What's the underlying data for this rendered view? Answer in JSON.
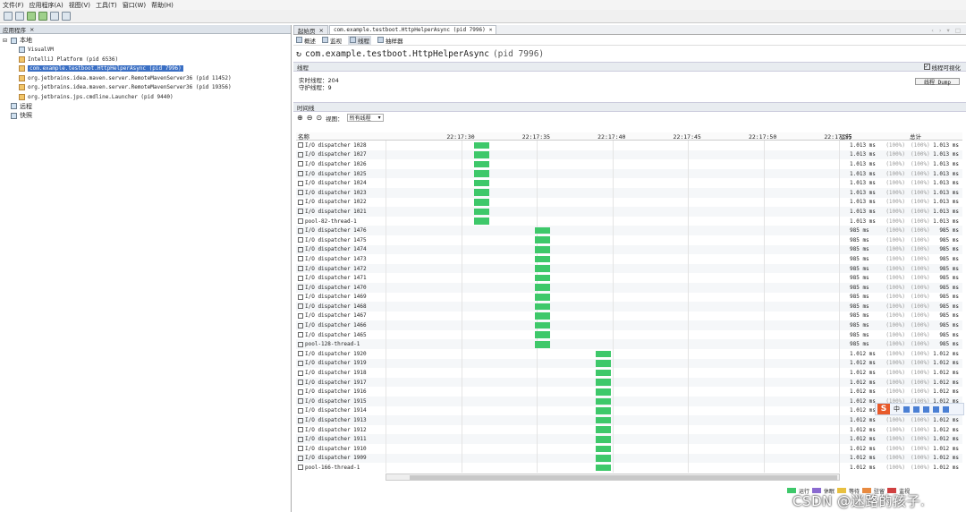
{
  "menu": [
    "文件(F)",
    "应用程序(A)",
    "视图(V)",
    "工具(T)",
    "窗口(W)",
    "帮助(H)"
  ],
  "left_tab": {
    "label": "应用程序",
    "close": "×"
  },
  "tree": {
    "local": "本地",
    "apps": [
      {
        "label": "VisualVM",
        "selected": false
      },
      {
        "label": "IntelliJ Platform (pid 6536)",
        "selected": false
      },
      {
        "label": "com.example.testboot.HttpHelperAsync (pid 7996)",
        "selected": true
      },
      {
        "label": "org.jetbrains.idea.maven.server.RemoteMavenServer36 (pid 11452)",
        "selected": false
      },
      {
        "label": "org.jetbrains.idea.maven.server.RemoteMavenServer36 (pid 19356)",
        "selected": false
      },
      {
        "label": "org.jetbrains.jps.cmdline.Launcher (pid 9440)",
        "selected": false
      }
    ],
    "remote": "远程",
    "snapshot": "快照"
  },
  "tabs": [
    {
      "label": "起始页",
      "close": "×"
    },
    {
      "label": "com.example.testboot.HttpHelperAsync (pid 7996)",
      "close": "×"
    }
  ],
  "tab_nav": "‹ › ▾ □",
  "subtabs": [
    "概述",
    "监视",
    "线程",
    "抽样器"
  ],
  "page_title": "com.example.testboot.HttpHelperAsync",
  "page_pid": "(pid 7996)",
  "threads_section": {
    "label": "线程",
    "visualize_label": "线程可视化",
    "visualize_checked": true
  },
  "stats": {
    "live": "实时线程：204",
    "daemon": "守护线程：9"
  },
  "dump_button": "线程 Dump",
  "timeline_label": "时间线",
  "view_label": "视图：",
  "view_select": "所有线程",
  "columns": {
    "name": "名称",
    "running": "运行",
    "total": "总计"
  },
  "ticks": [
    "22:17:30",
    "22:17:35",
    "22:17:40",
    "22:17:45",
    "22:17:50",
    "22:17:55"
  ],
  "rows": [
    {
      "name": "I/O dispatcher 1028",
      "bar": 0,
      "run": "1.013 ms",
      "pct": "(100%)",
      "total": "1.013 ms"
    },
    {
      "name": "I/O dispatcher 1027",
      "bar": 0,
      "run": "1.013 ms",
      "pct": "(100%)",
      "total": "1.013 ms"
    },
    {
      "name": "I/O dispatcher 1026",
      "bar": 0,
      "run": "1.013 ms",
      "pct": "(100%)",
      "total": "1.013 ms"
    },
    {
      "name": "I/O dispatcher 1025",
      "bar": 0,
      "run": "1.013 ms",
      "pct": "(100%)",
      "total": "1.013 ms"
    },
    {
      "name": "I/O dispatcher 1024",
      "bar": 0,
      "run": "1.013 ms",
      "pct": "(100%)",
      "total": "1.013 ms"
    },
    {
      "name": "I/O dispatcher 1023",
      "bar": 0,
      "run": "1.013 ms",
      "pct": "(100%)",
      "total": "1.013 ms"
    },
    {
      "name": "I/O dispatcher 1022",
      "bar": 0,
      "run": "1.013 ms",
      "pct": "(100%)",
      "total": "1.013 ms"
    },
    {
      "name": "I/O dispatcher 1021",
      "bar": 0,
      "run": "1.013 ms",
      "pct": "(100%)",
      "total": "1.013 ms"
    },
    {
      "name": "pool-82-thread-1",
      "bar": 0,
      "run": "1.013 ms",
      "pct": "(100%)",
      "total": "1.013 ms"
    },
    {
      "name": "I/O dispatcher 1476",
      "bar": 1,
      "run": "985 ms",
      "pct": "(100%)",
      "total": "985 ms"
    },
    {
      "name": "I/O dispatcher 1475",
      "bar": 1,
      "run": "985 ms",
      "pct": "(100%)",
      "total": "985 ms"
    },
    {
      "name": "I/O dispatcher 1474",
      "bar": 1,
      "run": "985 ms",
      "pct": "(100%)",
      "total": "985 ms"
    },
    {
      "name": "I/O dispatcher 1473",
      "bar": 1,
      "run": "985 ms",
      "pct": "(100%)",
      "total": "985 ms"
    },
    {
      "name": "I/O dispatcher 1472",
      "bar": 1,
      "run": "985 ms",
      "pct": "(100%)",
      "total": "985 ms"
    },
    {
      "name": "I/O dispatcher 1471",
      "bar": 1,
      "run": "985 ms",
      "pct": "(100%)",
      "total": "985 ms"
    },
    {
      "name": "I/O dispatcher 1470",
      "bar": 1,
      "run": "985 ms",
      "pct": "(100%)",
      "total": "985 ms"
    },
    {
      "name": "I/O dispatcher 1469",
      "bar": 1,
      "run": "985 ms",
      "pct": "(100%)",
      "total": "985 ms"
    },
    {
      "name": "I/O dispatcher 1468",
      "bar": 1,
      "run": "985 ms",
      "pct": "(100%)",
      "total": "985 ms"
    },
    {
      "name": "I/O dispatcher 1467",
      "bar": 1,
      "run": "985 ms",
      "pct": "(100%)",
      "total": "985 ms"
    },
    {
      "name": "I/O dispatcher 1466",
      "bar": 1,
      "run": "985 ms",
      "pct": "(100%)",
      "total": "985 ms"
    },
    {
      "name": "I/O dispatcher 1465",
      "bar": 1,
      "run": "985 ms",
      "pct": "(100%)",
      "total": "985 ms"
    },
    {
      "name": "pool-128-thread-1",
      "bar": 1,
      "run": "985 ms",
      "pct": "(100%)",
      "total": "985 ms"
    },
    {
      "name": "I/O dispatcher 1920",
      "bar": 2,
      "run": "1.012 ms",
      "pct": "(100%)",
      "total": "1.012 ms"
    },
    {
      "name": "I/O dispatcher 1919",
      "bar": 2,
      "run": "1.012 ms",
      "pct": "(100%)",
      "total": "1.012 ms"
    },
    {
      "name": "I/O dispatcher 1918",
      "bar": 2,
      "run": "1.012 ms",
      "pct": "(100%)",
      "total": "1.012 ms"
    },
    {
      "name": "I/O dispatcher 1917",
      "bar": 2,
      "run": "1.012 ms",
      "pct": "(100%)",
      "total": "1.012 ms"
    },
    {
      "name": "I/O dispatcher 1916",
      "bar": 2,
      "run": "1.012 ms",
      "pct": "(100%)",
      "total": "1.012 ms"
    },
    {
      "name": "I/O dispatcher 1915",
      "bar": 2,
      "run": "1.012 ms",
      "pct": "(100%)",
      "total": "1.012 ms"
    },
    {
      "name": "I/O dispatcher 1914",
      "bar": 2,
      "run": "1.012 ms",
      "pct": "(100%)",
      "total": "1.012 ms"
    },
    {
      "name": "I/O dispatcher 1913",
      "bar": 2,
      "run": "1.012 ms",
      "pct": "(100%)",
      "total": "1.012 ms"
    },
    {
      "name": "I/O dispatcher 1912",
      "bar": 2,
      "run": "1.012 ms",
      "pct": "(100%)",
      "total": "1.012 ms"
    },
    {
      "name": "I/O dispatcher 1911",
      "bar": 2,
      "run": "1.012 ms",
      "pct": "(100%)",
      "total": "1.012 ms"
    },
    {
      "name": "I/O dispatcher 1910",
      "bar": 2,
      "run": "1.012 ms",
      "pct": "(100%)",
      "total": "1.012 ms"
    },
    {
      "name": "I/O dispatcher 1909",
      "bar": 2,
      "run": "1.012 ms",
      "pct": "(100%)",
      "total": "1.012 ms"
    },
    {
      "name": "pool-166-thread-1",
      "bar": 2,
      "run": "1.012 ms",
      "pct": "(100%)",
      "total": "1.012 ms"
    }
  ],
  "legend": [
    "运行",
    "休眠",
    "等待",
    "驻留",
    "监视"
  ],
  "colors": {
    "running": "#3ec86a",
    "sleeping": "#8a6ad0",
    "wait": "#e8c040",
    "park": "#e88a40",
    "monitor": "#d04040"
  },
  "watermark": "CSDN @迷路的孩子.",
  "ime": {
    "logo": "S",
    "lang": "中"
  }
}
